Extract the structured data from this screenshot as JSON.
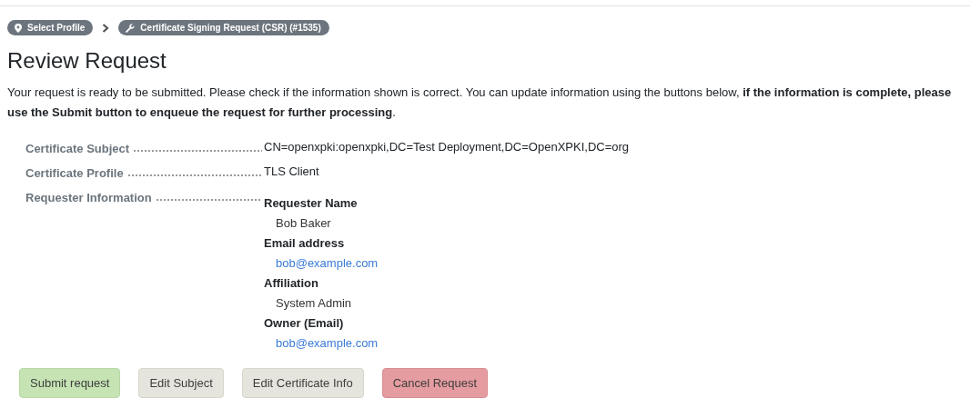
{
  "breadcrumbs": [
    {
      "label": "Select Profile"
    },
    {
      "label": "Certificate Signing Request (CSR) (#1535)"
    }
  ],
  "title": "Review Request",
  "intro": "Your request is ready to be submitted. Please check if the information shown is correct. You can update information using the buttons below, **if the information is complete, please use the Submit button to enqueue the request for further processing**.",
  "fields": [
    {
      "kind": "text",
      "label": "Certificate Subject",
      "value": "CN=openxpki:openxpki,DC=Test Deployment,DC=OpenXPKI,DC=org"
    },
    {
      "kind": "text",
      "label": "Certificate Profile",
      "value": "TLS Client"
    },
    {
      "kind": "group",
      "label": "Requester Information",
      "items": [
        {
          "label": "Requester Name",
          "value": "Bob Baker",
          "kind": "text"
        },
        {
          "label": "Email address",
          "value": "bob@example.com",
          "kind": "link"
        },
        {
          "label": "Affiliation",
          "value": "System Admin",
          "kind": "text"
        },
        {
          "label": "Owner (Email)",
          "value": "bob@example.com",
          "kind": "link"
        }
      ]
    }
  ],
  "buttons": [
    {
      "label": "Submit request",
      "kind": "submit"
    },
    {
      "label": "Edit Subject",
      "kind": "edit"
    },
    {
      "label": "Edit Certificate Info",
      "kind": "edit"
    },
    {
      "label": "Cancel Request",
      "kind": "cancel"
    }
  ]
}
